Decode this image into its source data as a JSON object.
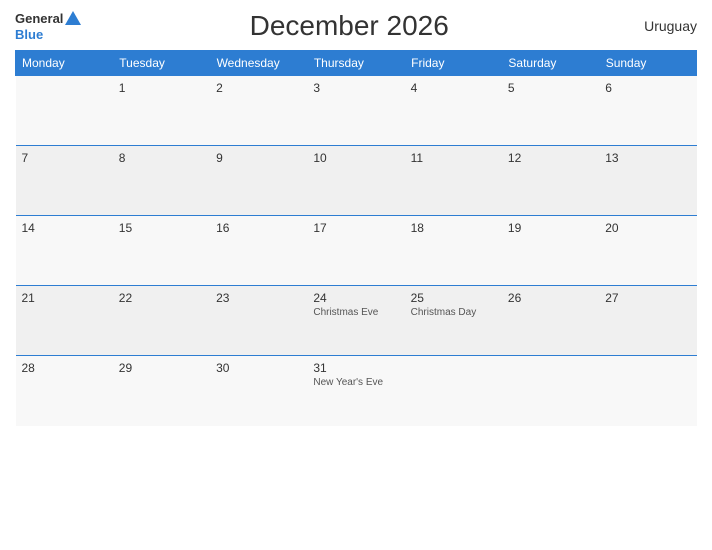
{
  "header": {
    "title": "December 2026",
    "country": "Uruguay",
    "logo": {
      "general": "General",
      "blue": "Blue"
    }
  },
  "days_of_week": [
    "Monday",
    "Tuesday",
    "Wednesday",
    "Thursday",
    "Friday",
    "Saturday",
    "Sunday"
  ],
  "weeks": [
    [
      {
        "num": "",
        "event": ""
      },
      {
        "num": "1",
        "event": ""
      },
      {
        "num": "2",
        "event": ""
      },
      {
        "num": "3",
        "event": ""
      },
      {
        "num": "4",
        "event": ""
      },
      {
        "num": "5",
        "event": ""
      },
      {
        "num": "6",
        "event": ""
      }
    ],
    [
      {
        "num": "7",
        "event": ""
      },
      {
        "num": "8",
        "event": ""
      },
      {
        "num": "9",
        "event": ""
      },
      {
        "num": "10",
        "event": ""
      },
      {
        "num": "11",
        "event": ""
      },
      {
        "num": "12",
        "event": ""
      },
      {
        "num": "13",
        "event": ""
      }
    ],
    [
      {
        "num": "14",
        "event": ""
      },
      {
        "num": "15",
        "event": ""
      },
      {
        "num": "16",
        "event": ""
      },
      {
        "num": "17",
        "event": ""
      },
      {
        "num": "18",
        "event": ""
      },
      {
        "num": "19",
        "event": ""
      },
      {
        "num": "20",
        "event": ""
      }
    ],
    [
      {
        "num": "21",
        "event": ""
      },
      {
        "num": "22",
        "event": ""
      },
      {
        "num": "23",
        "event": ""
      },
      {
        "num": "24",
        "event": "Christmas Eve"
      },
      {
        "num": "25",
        "event": "Christmas Day"
      },
      {
        "num": "26",
        "event": ""
      },
      {
        "num": "27",
        "event": ""
      }
    ],
    [
      {
        "num": "28",
        "event": ""
      },
      {
        "num": "29",
        "event": ""
      },
      {
        "num": "30",
        "event": ""
      },
      {
        "num": "31",
        "event": "New Year's Eve"
      },
      {
        "num": "",
        "event": ""
      },
      {
        "num": "",
        "event": ""
      },
      {
        "num": "",
        "event": ""
      }
    ]
  ]
}
